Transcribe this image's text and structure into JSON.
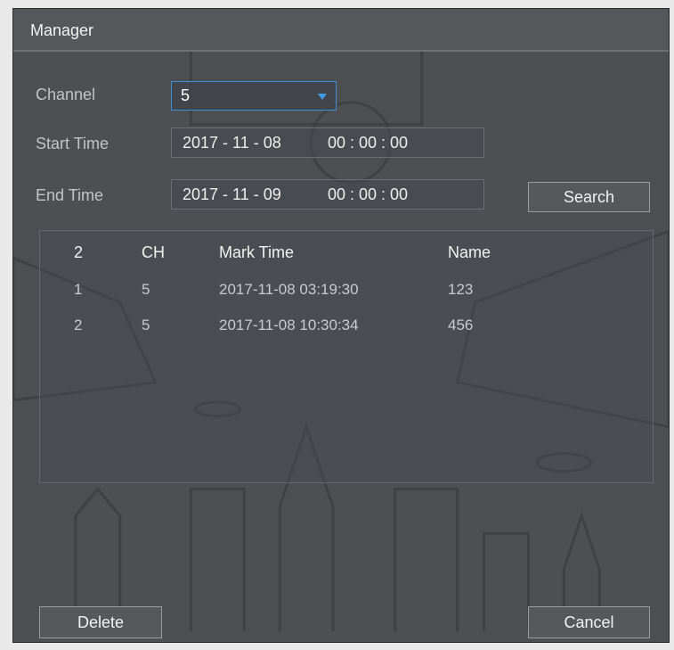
{
  "dialog": {
    "title": "Manager"
  },
  "form": {
    "channel_label": "Channel",
    "channel_value": "5",
    "start_label": "Start Time",
    "start_date": "2017 - 11 - 08",
    "start_time": "00 : 00 : 00",
    "end_label": "End Time",
    "end_date": "2017 - 11 - 09",
    "end_time": "00 : 00 : 00",
    "search_label": "Search"
  },
  "table": {
    "headers": [
      "2",
      "CH",
      "Mark Time",
      "Name"
    ],
    "rows": [
      [
        "1",
        "5",
        "2017-11-08 03:19:30",
        "123"
      ],
      [
        "2",
        "5",
        "2017-11-08 10:30:34",
        "456"
      ]
    ]
  },
  "footer": {
    "delete_label": "Delete",
    "cancel_label": "Cancel"
  },
  "colors": {
    "accent": "#3f8fd6",
    "panel": "#4d4f53"
  }
}
